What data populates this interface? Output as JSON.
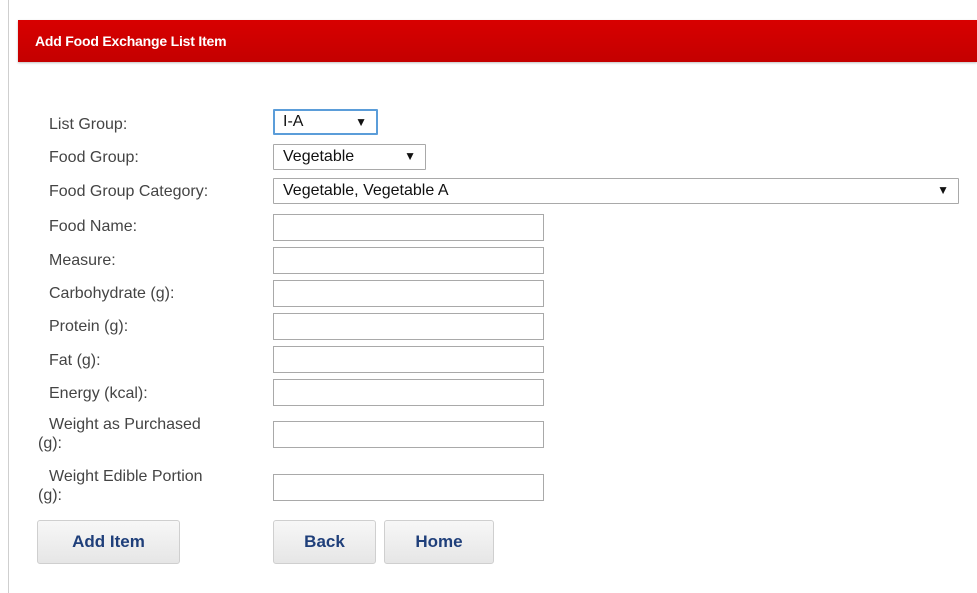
{
  "header": {
    "title": "Add Food Exchange List Item"
  },
  "form": {
    "list_group": {
      "label": "List Group:",
      "value": "I-A"
    },
    "food_group": {
      "label": "Food Group:",
      "value": "Vegetable"
    },
    "food_group_category": {
      "label": "Food Group Category:",
      "value": "Vegetable, Vegetable A"
    },
    "food_name": {
      "label": "Food Name:",
      "value": ""
    },
    "measure": {
      "label": "Measure:",
      "value": ""
    },
    "carbohydrate": {
      "label": "Carbohydrate (g):",
      "value": ""
    },
    "protein": {
      "label": "Protein (g):",
      "value": ""
    },
    "fat": {
      "label": "Fat (g):",
      "value": ""
    },
    "energy": {
      "label": "Energy (kcal):",
      "value": ""
    },
    "weight_purchased": {
      "label_line1": "Weight as Purchased",
      "label_line2": "(g):",
      "value": ""
    },
    "weight_edible": {
      "label_line1": "Weight Edible Portion",
      "label_line2": "(g):",
      "value": ""
    }
  },
  "buttons": {
    "add_item": "Add Item",
    "back": "Back",
    "home": "Home"
  },
  "icons": {
    "dropdown_arrow": "▼"
  },
  "colors": {
    "header": "#d00000",
    "button_text": "#1f3f7a"
  }
}
